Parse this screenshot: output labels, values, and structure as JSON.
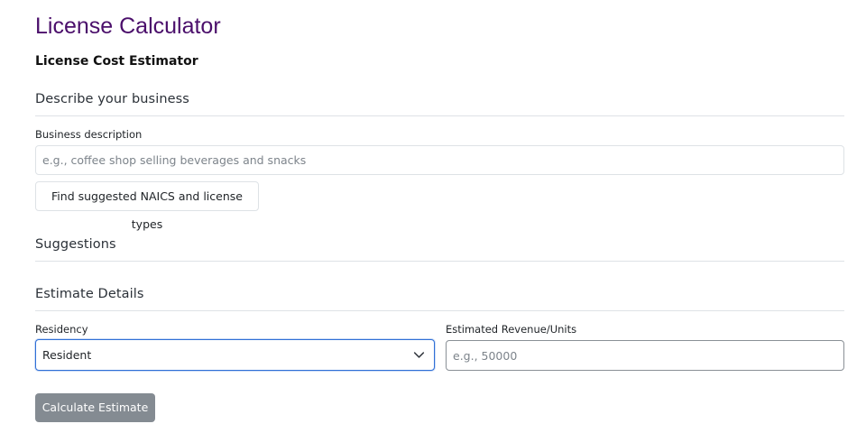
{
  "app": {
    "title": "License Calculator"
  },
  "page": {
    "subtitle": "License Cost Estimator"
  },
  "describe": {
    "heading": "Describe your business",
    "description_label": "Business description",
    "description_placeholder": "e.g., coffee shop selling beverages and snacks",
    "description_value": "",
    "suggest_button": "Find suggested NAICS and license types"
  },
  "suggestions": {
    "heading": "Suggestions"
  },
  "estimate": {
    "heading": "Estimate Details",
    "residency_label": "Residency",
    "residency_value": "Resident",
    "revenue_label": "Estimated Revenue/Units",
    "revenue_placeholder": "e.g., 50000",
    "revenue_value": "",
    "calculate_button": "Calculate Estimate"
  },
  "icons": {
    "select_chevron": "chevron-down-icon"
  },
  "colors": {
    "title": "#4b0f6b",
    "focus_border": "#2f6fd6",
    "primary_button": "#848b92",
    "divider": "#dee2e6"
  }
}
